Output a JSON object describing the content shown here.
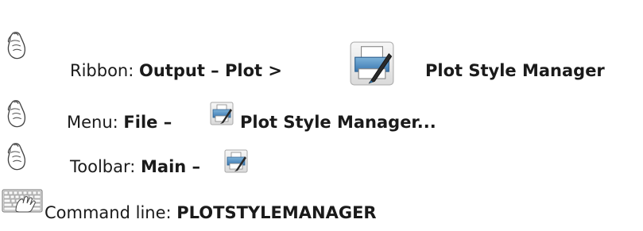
{
  "instructions": [
    {
      "method": "mouse",
      "icon": "hand-mouse-icon",
      "label": "Ribbon: ",
      "bold_before_icon": "Output – Plot > ",
      "command_icon": "plot-style-manager-large-icon",
      "bold_after_icon": "Plot Style Manager"
    },
    {
      "method": "mouse",
      "icon": "hand-mouse-icon",
      "label": "Menu: ",
      "bold_before_icon": "File – ",
      "command_icon": "plot-style-manager-small-icon",
      "bold_after_icon": "Plot Style Manager..."
    },
    {
      "method": "mouse",
      "icon": "hand-mouse-icon",
      "label": "Toolbar: ",
      "bold_before_icon": "Main – ",
      "command_icon": "plot-style-manager-small-icon"
    },
    {
      "method": "keyboard",
      "icon": "hand-keyboard-icon",
      "label": "Command line: ",
      "bold_command": "PLOTSTYLEMANAGER"
    }
  ]
}
